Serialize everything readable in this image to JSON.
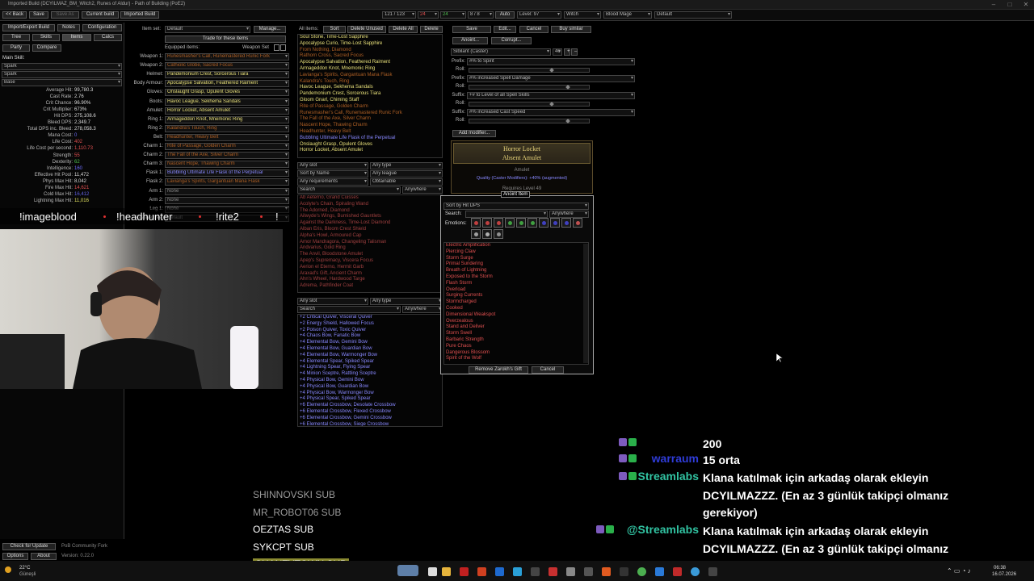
{
  "window": {
    "title": "Imported Build (DCYILMAZ_BM_Witch2, Runes of Aldur) - Path of Building (PoE2)"
  },
  "toolbar": {
    "back": "<< Back",
    "save": "Save",
    "save_as": "Save As",
    "current_build": "Current build",
    "imported_build": "Imported Build",
    "points": "121 / 123",
    "ascend_a": "24",
    "ascend_b": "24",
    "ascend_c": "8 / 8",
    "auto": "Auto",
    "level": "Level: 97",
    "class": "Witch",
    "ascendancy": "Blood Mage",
    "config": "Default"
  },
  "left": {
    "tabs_row1": [
      "Import/Export Build",
      "Notes",
      "Configuration"
    ],
    "tabs_row2": [
      "Tree",
      "Skills",
      "Items",
      "Calcs"
    ],
    "tabs_row3": [
      "Party",
      "Compare"
    ],
    "main_skill_label": "Main Skill:",
    "skill_selects": [
      "Spark",
      "Spark",
      "Base"
    ],
    "stats": [
      {
        "label": "Average Hit:",
        "value": "99,780.3",
        "color": "#ddd"
      },
      {
        "label": "Cast Rate:",
        "value": "2.76",
        "color": "#ddd"
      },
      {
        "label": "Crit Chance:",
        "value": "96.90%",
        "color": "#ddd"
      },
      {
        "label": "Crit Multiplier:",
        "value": "673%",
        "color": "#ddd"
      },
      {
        "label": "Hit DPS:",
        "value": "275,108.6",
        "color": "#ddd"
      },
      {
        "label": "Bleed DPS:",
        "value": "2,349.7",
        "color": "#ddd"
      },
      {
        "label": "Total DPS inc. Bleed:",
        "value": "278,058.3",
        "color": "#ddd"
      },
      {
        "label": "Mana Cost:",
        "value": "0",
        "color": "#7070ff"
      },
      {
        "label": "Life Cost:",
        "value": "402",
        "color": "#e05050"
      },
      {
        "label": "Life Cost per second:",
        "value": "1,110.73",
        "color": "#e05050"
      },
      {
        "label": "Strength:",
        "value": "55",
        "color": "#e05050"
      },
      {
        "label": "Dexterity:",
        "value": "62",
        "color": "#50c050"
      },
      {
        "label": "Intelligence:",
        "value": "160",
        "color": "#7070ff"
      },
      {
        "label": "Effective Hit Pool:",
        "value": "11,472",
        "color": "#ddd"
      },
      {
        "label": "Phys Max Hit:",
        "value": "8,042",
        "color": "#ddd"
      },
      {
        "label": "Fire Max Hit:",
        "value": "14,621",
        "color": "#e05050"
      },
      {
        "label": "Cold Max Hit:",
        "value": "16,412",
        "color": "#6060e0"
      },
      {
        "label": "Lightning Max Hit:",
        "value": "11,016",
        "color": "#e0e060"
      }
    ],
    "bottom_buttons": [
      "Check for Update",
      "PoB Community Fork",
      "Options",
      "About"
    ],
    "version": "Version: 0.22.0"
  },
  "overlay_commands": [
    "!imageblood",
    "!headhunter",
    "!rite2",
    "!"
  ],
  "equip": {
    "item_set_label": "Item set:",
    "item_set_value": "Default",
    "manage": "Manage...",
    "trade_button": "Trade for these items",
    "equipped_label": "Equipped items:",
    "weapon_set_label": "Weapon Set",
    "slots": [
      {
        "slot": "Weapon 1:",
        "item": "Runesmasher's Call, Runemastered Runic Fork",
        "color": "#af6025"
      },
      {
        "slot": "Weapon 2:",
        "item": "Cathiolic Globe, Sacred Focus",
        "color": "#af6025"
      },
      {
        "slot": "Helmet:",
        "item": "Pandemonium Crest, Sorcerous Tiara",
        "color": "#e8e07a"
      },
      {
        "slot": "Body Armour:",
        "item": "Apocalypse Salvation, Feathered Raiment",
        "color": "#e8e07a"
      },
      {
        "slot": "Gloves:",
        "item": "Onslaught Grasp, Opulent Gloves",
        "color": "#e8e07a"
      },
      {
        "slot": "Boots:",
        "item": "Havoc League, Sekhema Sandals",
        "color": "#e8e07a"
      },
      {
        "slot": "Amulet:",
        "item": "Horror Locket, Absent Amulet",
        "color": "#e8e07a"
      },
      {
        "slot": "Ring 1:",
        "item": "Armageddon Knot, Mnemonic Ring",
        "color": "#e8e07a"
      },
      {
        "slot": "Ring 2:",
        "item": "Kalandra's Touch, Ring",
        "color": "#af6025"
      },
      {
        "slot": "Belt:",
        "item": "Headhunter, Heavy Belt",
        "color": "#af6025"
      },
      {
        "slot": "Charm 1:",
        "item": "Rite of Passage, Golden Charm",
        "color": "#af6025"
      },
      {
        "slot": "Charm 2:",
        "item": "The Fall of the Axe, Silver Charm",
        "color": "#af6025"
      },
      {
        "slot": "Charm 3:",
        "item": "Nascent Hope, Thawing Charm",
        "color": "#af6025"
      },
      {
        "slot": "Flask 1:",
        "item": "Bubbling Ultimate Life Flask of the Perpetual",
        "color": "#8888ff"
      },
      {
        "slot": "Flask 2:",
        "item": "Lavianga's Spirits, Gargantuan Mana Flask",
        "color": "#af6025"
      },
      {
        "slot": "Arm 1:",
        "item": "None",
        "color": "#888"
      },
      {
        "slot": "Arm 2:",
        "item": "None",
        "color": "#888"
      },
      {
        "slot": "Leg 1:",
        "item": "None",
        "color": "#888"
      },
      {
        "slot": "Passive tree:",
        "item": "Default",
        "color": "#888"
      }
    ],
    "manage2": "Manage..."
  },
  "all_items": {
    "label": "All items:",
    "sort": "Sort",
    "delete_unused": "Delete Unused",
    "delete_all": "Delete All",
    "delete": "Delete",
    "items": [
      {
        "t": "Soul Stone, Time-Lost Sapphire",
        "c": "rare"
      },
      {
        "t": "Apocalypse Curio, Time-Lost Sapphire",
        "c": "rare"
      },
      {
        "t": "From Nothing, Diamond",
        "c": "unique"
      },
      {
        "t": "Rathorn Cross, Sacred Focus",
        "c": "unique"
      },
      {
        "t": "Apocalypse Salvation, Feathered Raiment",
        "c": "rare"
      },
      {
        "t": "Armageddon Knot, Mnemonic Ring",
        "c": "rare"
      },
      {
        "t": "Lavianga's Spirits, Gargantuan Mana Flask",
        "c": "unique"
      },
      {
        "t": "Kalandra's Touch, Ring",
        "c": "unique"
      },
      {
        "t": "Havoc League, Sekhema Sandals",
        "c": "rare"
      },
      {
        "t": "Pandemonium Crest, Sorcerous Tiara",
        "c": "rare"
      },
      {
        "t": "Gloom Gnarl, Chiming Staff",
        "c": "rare"
      },
      {
        "t": "Rite of Passage, Golden Charm",
        "c": "unique"
      },
      {
        "t": "Runesmasher's Call, Runemastered Runic Fork",
        "c": "unique"
      },
      {
        "t": "The Fall of the Axe, Silver Charm",
        "c": "unique"
      },
      {
        "t": "Nascent Hope, Thawing Charm",
        "c": "unique"
      },
      {
        "t": "Headhunter, Heavy Belt",
        "c": "unique"
      },
      {
        "t": "Bubbling Ultimate Life Flask of the Perpetual",
        "c": "blue"
      },
      {
        "t": "Onslaught Grasp, Opulent Gloves",
        "c": "rare"
      },
      {
        "t": "Horror Locket, Absent Amulet",
        "c": "rare"
      }
    ]
  },
  "db1": {
    "filters": [
      "Any slot",
      "Any type",
      "Sort by Name",
      "Any league",
      "Any requirements",
      "Obtainable"
    ],
    "search": "Search",
    "where": "Anywhere",
    "items": [
      "Ab Aeterno, Grand Cuisses",
      "Acolyte's Chain, Spiraling Wand",
      "The Adorned, Diamond",
      "Ailwyde's Wings, Burnished Gauntlets",
      "Against the Darkness, Time-Lost Diamond",
      "Alban Eris, Bloom Crest Shield",
      "Alpha's Howl, Armoured Cap",
      "Amor Mandragora, Changeling Talisman",
      "Andvarius, Gold Ring",
      "The Anvil, Bloodstone Amulet",
      "Apep's Supremacy, Viscera Focus",
      "Aerion el Eterno, Hermit Garb",
      "Araxad's Gift, Ancient Charm",
      "Ahn's Wheel, Hardwood Targe",
      "Adrema, Pathfinder Coat"
    ]
  },
  "db2": {
    "filters": [
      "Any slot",
      "Any type"
    ],
    "search": "Search",
    "where": "Anywhere",
    "items": [
      "+2 Critical Quiver, Visceral Quiver",
      "+2 Energy Shield, Hallowed Focus",
      "+2 Poison Quiver, Toxic Quiver",
      "+4 Chaos Bow, Fanatic Bow",
      "+4 Elemental Bow, Gemini Bow",
      "+4 Elemental Bow, Guardian Bow",
      "+4 Elemental Bow, Warmonger Bow",
      "+4 Elemental Spear, Spiked Spear",
      "+4 Lightning Spear, Flying Spear",
      "+4 Minion Sceptre, Rattling Sceptre",
      "+4 Physical Bow, Gemini Bow",
      "+4 Physical Bow, Guardian Bow",
      "+4 Physical Bow, Warmonger Bow",
      "+4 Physical Spear, Spiked Spear",
      "+6 Elemental Crossbow, Desolate Crossbow",
      "+6 Elemental Crossbow, Flexed Crossbow",
      "+6 Elemental Crossbow, Gemini Crossbow",
      "+6 Elemental Crossbow, Siege Crossbow"
    ]
  },
  "editor": {
    "buttons": [
      "Save",
      "Edit...",
      "Cancel",
      "Buy similar"
    ],
    "anoint": "Anoint...",
    "corrupt": "Corrupt...",
    "base": "Sibilant (Caster)",
    "ilvl": "40",
    "mods": [
      {
        "label": "Prefix:",
        "value": "#% to Spirit"
      },
      {
        "label": "Prefix:",
        "value": "#% increased Spell Damage"
      },
      {
        "label": "Suffix:",
        "value": "+# to Level of all Spell Skills"
      },
      {
        "label": "Suffix:",
        "value": "#% increased Cast Speed"
      }
    ],
    "roll_label": "Roll:",
    "add_modifier": "Add modifier...",
    "tooltip": {
      "name": "Horror Locket",
      "base": "Absent Amulet",
      "type": "Amulet",
      "quality": "Quality (Caster Modifiers): +40% (augmented)",
      "req": "Requires Level 49"
    }
  },
  "anoint": {
    "title": "Anoint Item",
    "sort": "Sort by Hit DPS",
    "search_label": "Search:",
    "where": "Anywhere",
    "emotions_label": "Emotions:",
    "emotion_colors": [
      "#c04040",
      "#c04040",
      "#c04040",
      "#40a040",
      "#40a040",
      "#40a040",
      "#4040c0",
      "#4040c0",
      "#4040c0",
      "#c05050",
      "#a0a0a0",
      "#b0b0b0",
      "#909090"
    ],
    "items": [
      "Electric Amplification",
      "Piercing Claw",
      "Storm Surge",
      "Primal Sundering",
      "Breath of Lightning",
      "Exposed to the Storm",
      "Flash Storm",
      "Overload",
      "Surging Currents",
      "Stormcharged",
      "Cooked",
      "Dimensional Weakspot",
      "Overzealous",
      "Stand and Deliver",
      "Storm Swell",
      "Barbaric Strength",
      "Pure Chaos",
      "Dangerous Blossom",
      "Spirit of the Wolf"
    ],
    "remove": "Remove Zarokh's Gift",
    "cancel": "Cancel"
  },
  "stream": {
    "subs": [
      "SHINNOVSKI  SUB",
      "MR_ROBOT06  SUB",
      "OEZTAS  SUB",
      "SYKCPT  SUB",
      "SHANTYTOWN  SUB"
    ],
    "chat": [
      {
        "user": "",
        "msg": "200",
        "ucolor": "#7d5bbe"
      },
      {
        "user": "warraum",
        "msg": "15 orta",
        "ucolor": "#2f3cd8"
      },
      {
        "user": "Streamlabs",
        "msg": "Klana katılmak için arkadaş olarak ekleyin DCYILMAZZZ. (En az 3 günlük takipçi olmanız gerekiyor)",
        "ucolor": "#31c3a2"
      },
      {
        "user": "@Streamlabs",
        "msg": "Klana katılmak için arkadaş olarak ekleyin DCYILMAZZZ. (En az 3 günlük takipçi olmanız gerekiyor)",
        "ucolor": "#31c3a2"
      }
    ]
  },
  "taskbar": {
    "temp": "22°C",
    "weather": "Güneşli",
    "time": "06:38",
    "date": "16.07.2026"
  }
}
